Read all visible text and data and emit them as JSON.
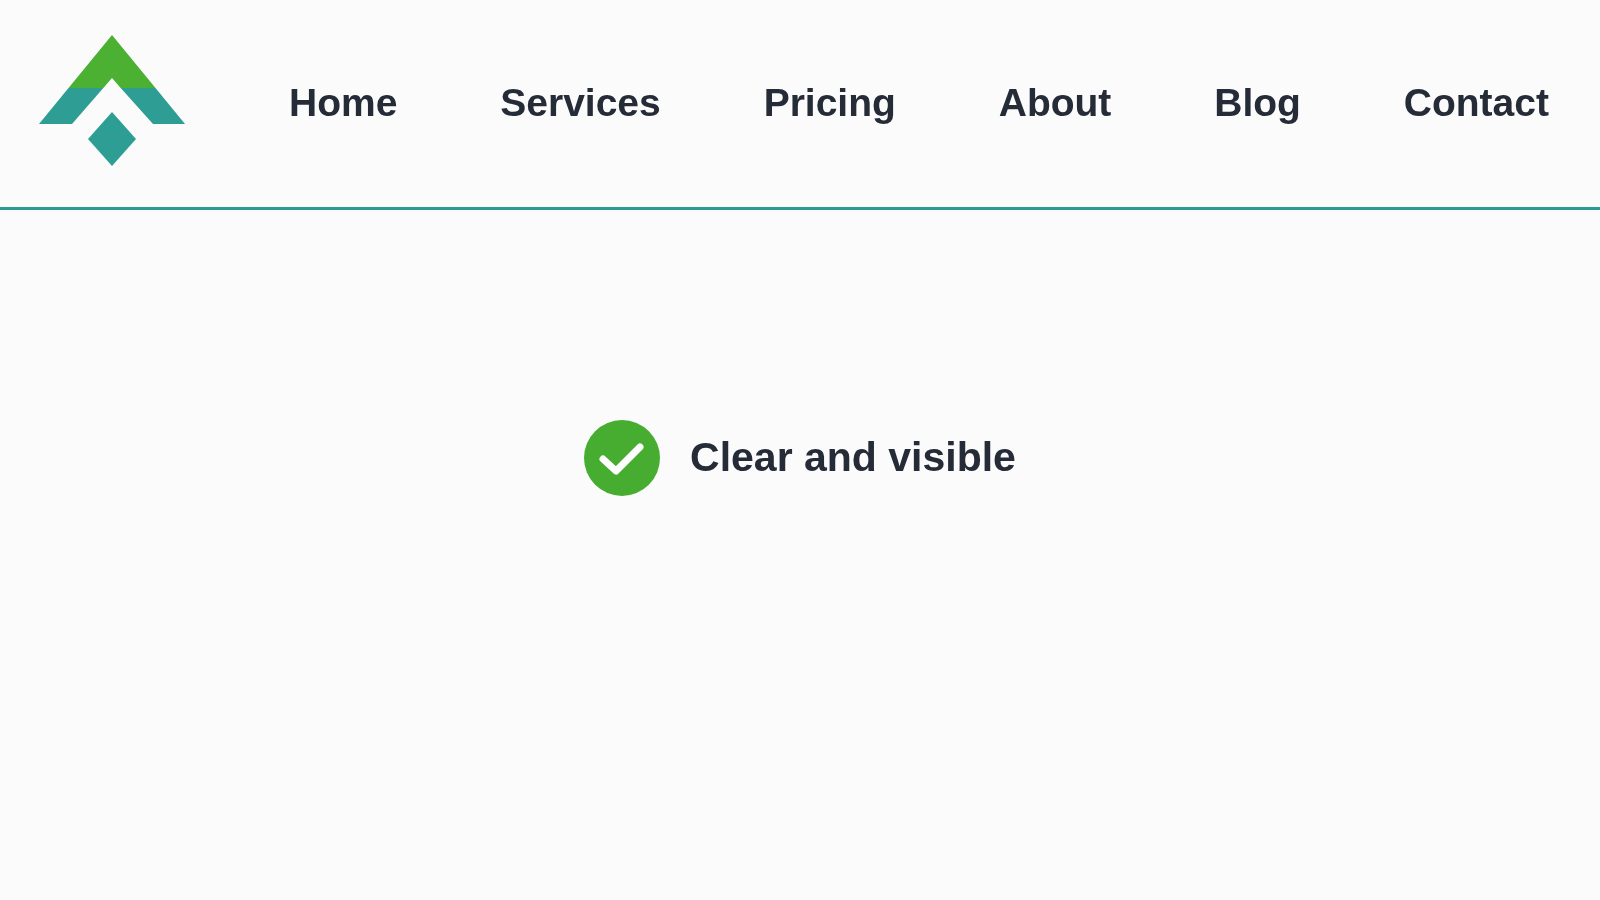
{
  "header": {
    "nav": [
      {
        "label": "Home"
      },
      {
        "label": "Services"
      },
      {
        "label": "Pricing"
      },
      {
        "label": "About"
      },
      {
        "label": "Blog"
      },
      {
        "label": "Contact"
      }
    ]
  },
  "status": {
    "label": "Clear and visible"
  }
}
